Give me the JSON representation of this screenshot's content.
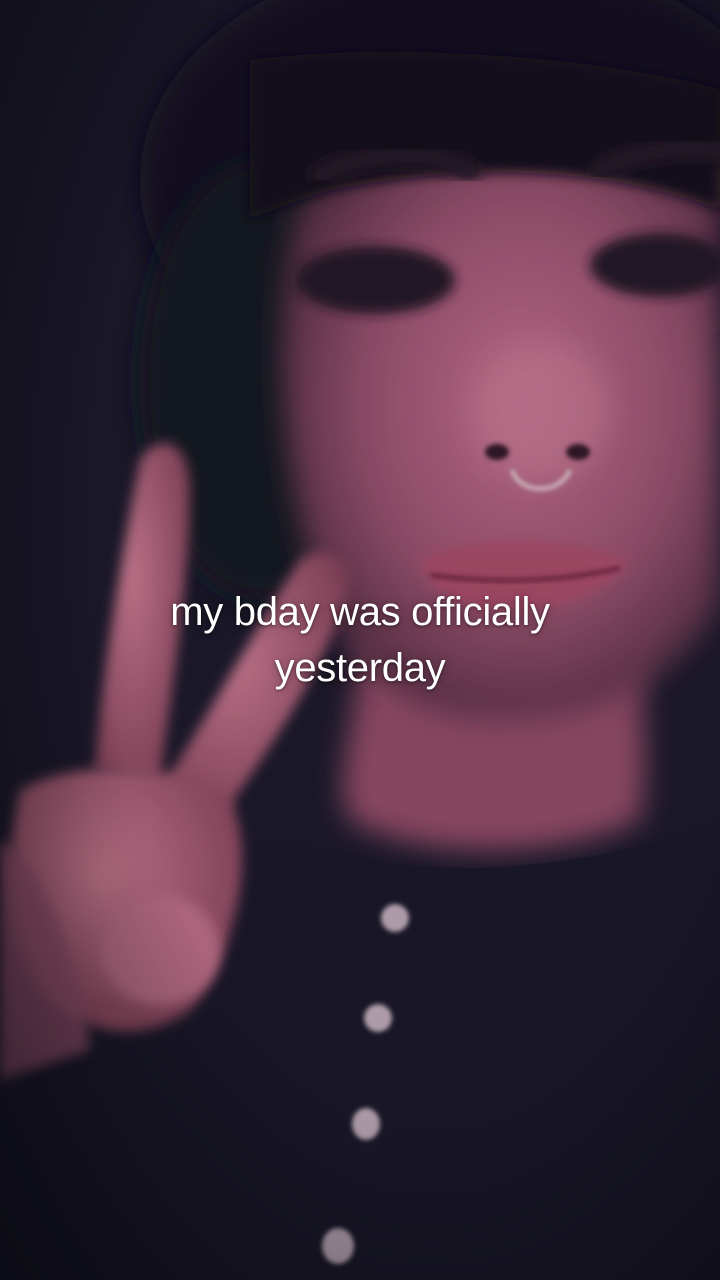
{
  "caption": {
    "line1": "my bday was officially",
    "line2": "yesterday"
  }
}
